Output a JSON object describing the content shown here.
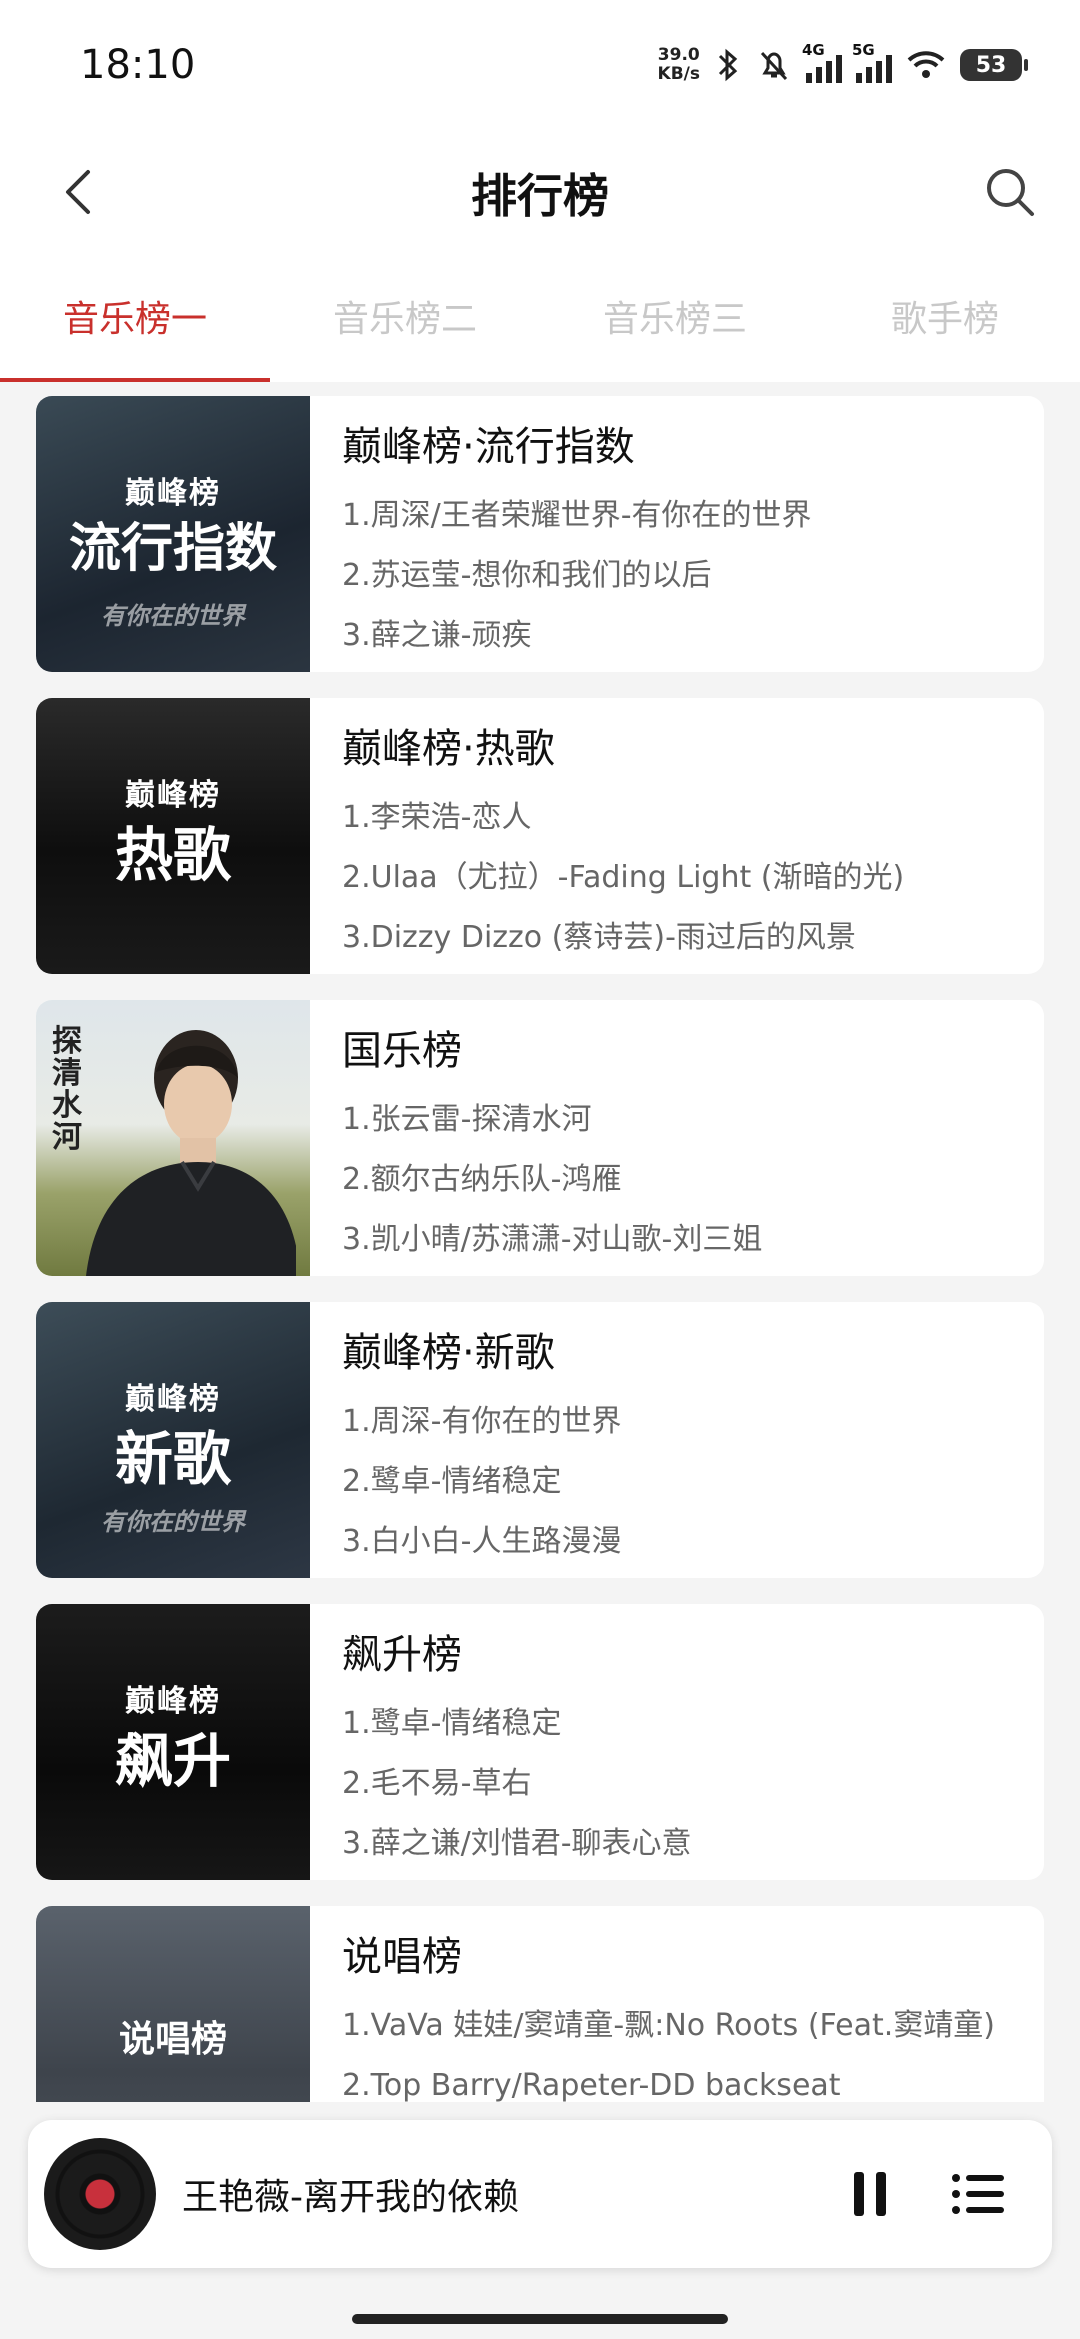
{
  "status": {
    "time": "18:10",
    "speed_value": "39.0",
    "speed_unit": "KB/s",
    "sig1": "4G",
    "sig2": "5G",
    "battery": "53"
  },
  "header": {
    "title": "排行榜"
  },
  "tabs": [
    {
      "label": "音乐榜一",
      "active": true
    },
    {
      "label": "音乐榜二",
      "active": false
    },
    {
      "label": "音乐榜三",
      "active": false
    },
    {
      "label": "歌手榜",
      "active": false
    }
  ],
  "charts": [
    {
      "title": "巅峰榜·流行指数",
      "cover": {
        "brand": "巅峰榜",
        "big": "流行指数",
        "sub": "有你在的世界"
      },
      "songs": [
        "1.周深/王者荣耀世界-有你在的世界",
        "2.苏运莹-想你和我们的以后",
        "3.薛之谦-顽疾"
      ]
    },
    {
      "title": "巅峰榜·热歌",
      "cover": {
        "brand": "巅峰榜",
        "big": "热歌",
        "sub": ""
      },
      "songs": [
        "1.李荣浩-恋人",
        "2.Ulaa（尤拉）-Fading Light (渐暗的光)",
        "3.Dizzy Dizzo (蔡诗芸)-雨过后的风景"
      ]
    },
    {
      "title": "国乐榜",
      "cover": {
        "brand": "探清水河",
        "big": "",
        "sub": ""
      },
      "songs": [
        "1.张云雷-探清水河",
        "2.额尔古纳乐队-鸿雁",
        "3.凯小晴/苏潇潇-对山歌-刘三姐"
      ]
    },
    {
      "title": "巅峰榜·新歌",
      "cover": {
        "brand": "巅峰榜",
        "big": "新歌",
        "sub": "有你在的世界"
      },
      "songs": [
        "1.周深-有你在的世界",
        "2.鹭卓-情绪稳定",
        "3.白小白-人生路漫漫"
      ]
    },
    {
      "title": "飙升榜",
      "cover": {
        "brand": "巅峰榜",
        "big": "飙升",
        "sub": ""
      },
      "songs": [
        "1.鹭卓-情绪稳定",
        "2.毛不易-草右",
        "3.薛之谦/刘惜君-聊表心意"
      ]
    },
    {
      "title": "说唱榜",
      "cover": {
        "brand": "",
        "big": "说唱榜",
        "sub": ""
      },
      "songs": [
        "1.VaVa 娃娃/窦靖童-飘:No Roots (Feat.窦靖童)",
        "2.Top Barry/Rapeter-DD backseat",
        ""
      ]
    }
  ],
  "player": {
    "now_playing": "王艳薇-离开我的依赖"
  },
  "colors": {
    "accent": "#c9302c",
    "background": "#f4f4f4"
  }
}
